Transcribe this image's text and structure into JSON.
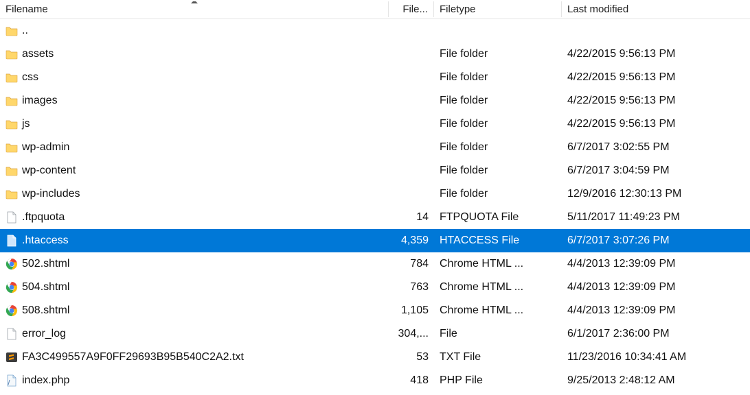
{
  "headers": {
    "name": "Filename",
    "size": "File...",
    "type": "Filetype",
    "date": "Last modified"
  },
  "rows": [
    {
      "icon": "folder",
      "name": "..",
      "size": "",
      "type": "",
      "date": "",
      "selected": false
    },
    {
      "icon": "folder",
      "name": "assets",
      "size": "",
      "type": "File folder",
      "date": "4/22/2015 9:56:13 PM",
      "selected": false
    },
    {
      "icon": "folder",
      "name": "css",
      "size": "",
      "type": "File folder",
      "date": "4/22/2015 9:56:13 PM",
      "selected": false
    },
    {
      "icon": "folder",
      "name": "images",
      "size": "",
      "type": "File folder",
      "date": "4/22/2015 9:56:13 PM",
      "selected": false
    },
    {
      "icon": "folder",
      "name": "js",
      "size": "",
      "type": "File folder",
      "date": "4/22/2015 9:56:13 PM",
      "selected": false
    },
    {
      "icon": "folder",
      "name": "wp-admin",
      "size": "",
      "type": "File folder",
      "date": "6/7/2017 3:02:55 PM",
      "selected": false
    },
    {
      "icon": "folder",
      "name": "wp-content",
      "size": "",
      "type": "File folder",
      "date": "6/7/2017 3:04:59 PM",
      "selected": false
    },
    {
      "icon": "folder",
      "name": "wp-includes",
      "size": "",
      "type": "File folder",
      "date": "12/9/2016 12:30:13 PM",
      "selected": false
    },
    {
      "icon": "file",
      "name": ".ftpquota",
      "size": "14",
      "type": "FTPQUOTA File",
      "date": "5/11/2017 11:49:23 PM",
      "selected": false
    },
    {
      "icon": "file",
      "name": ".htaccess",
      "size": "4,359",
      "type": "HTACCESS File",
      "date": "6/7/2017 3:07:26 PM",
      "selected": true
    },
    {
      "icon": "chrome",
      "name": "502.shtml",
      "size": "784",
      "type": "Chrome HTML ...",
      "date": "4/4/2013 12:39:09 PM",
      "selected": false
    },
    {
      "icon": "chrome",
      "name": "504.shtml",
      "size": "763",
      "type": "Chrome HTML ...",
      "date": "4/4/2013 12:39:09 PM",
      "selected": false
    },
    {
      "icon": "chrome",
      "name": "508.shtml",
      "size": "1,105",
      "type": "Chrome HTML ...",
      "date": "4/4/2013 12:39:09 PM",
      "selected": false
    },
    {
      "icon": "file",
      "name": "error_log",
      "size": "304,...",
      "type": "File",
      "date": "6/1/2017 2:36:00 PM",
      "selected": false
    },
    {
      "icon": "sublime",
      "name": "FA3C499557A9F0FF29693B95B540C2A2.txt",
      "size": "53",
      "type": "TXT File",
      "date": "11/23/2016 10:34:41 AM",
      "selected": false
    },
    {
      "icon": "php",
      "name": "index.php",
      "size": "418",
      "type": "PHP File",
      "date": "9/25/2013 2:48:12 AM",
      "selected": false
    }
  ]
}
